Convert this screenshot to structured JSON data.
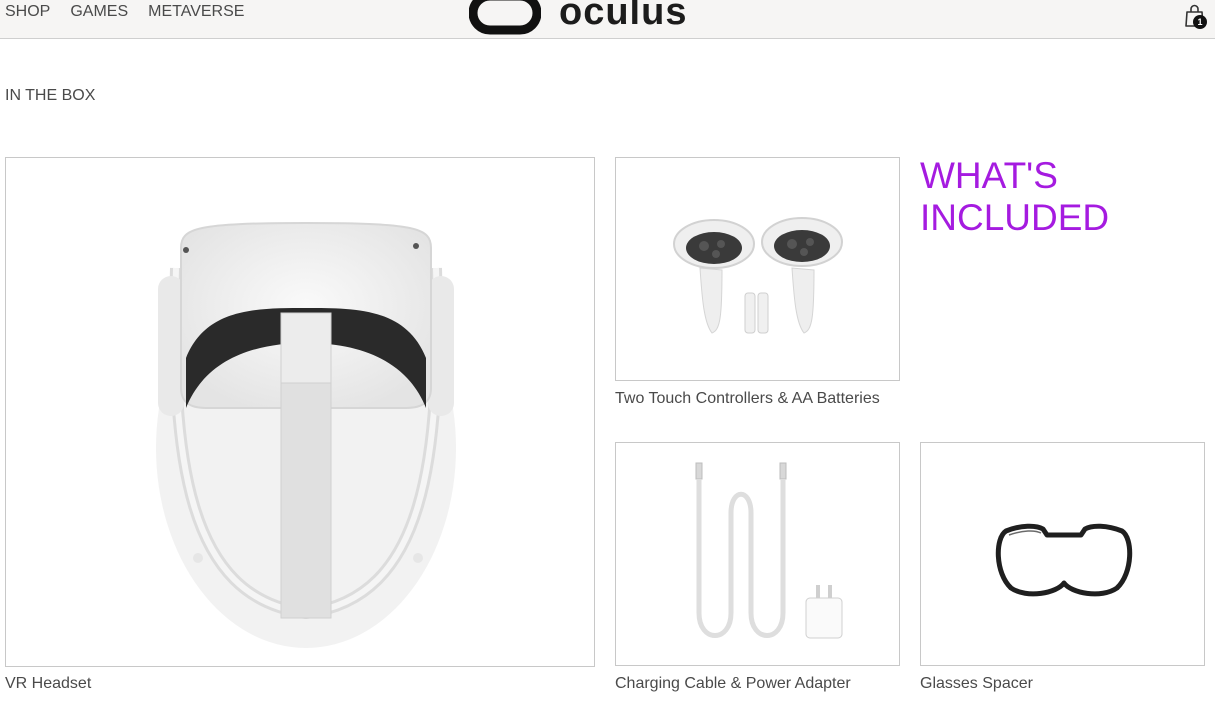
{
  "nav": {
    "items": [
      {
        "label": "SHOP"
      },
      {
        "label": "GAMES"
      },
      {
        "label": "METAVERSE"
      }
    ]
  },
  "brand": {
    "name": "oculus",
    "icon": "oculus-logo-mark"
  },
  "cart": {
    "icon": "shopping-bag-icon",
    "count": "1"
  },
  "section": {
    "title": "IN THE BOX",
    "heading": "WHAT'S INCLUDED",
    "heading_color": "#a51be0"
  },
  "items": [
    {
      "caption": "VR Headset",
      "image": "vr-headset-image"
    },
    {
      "caption": "Two Touch Controllers & AA Batteries",
      "image": "touch-controllers-image"
    },
    {
      "caption": "Charging Cable & Power Adapter",
      "image": "charging-cable-image"
    },
    {
      "caption": "Glasses Spacer",
      "image": "glasses-spacer-image"
    }
  ]
}
